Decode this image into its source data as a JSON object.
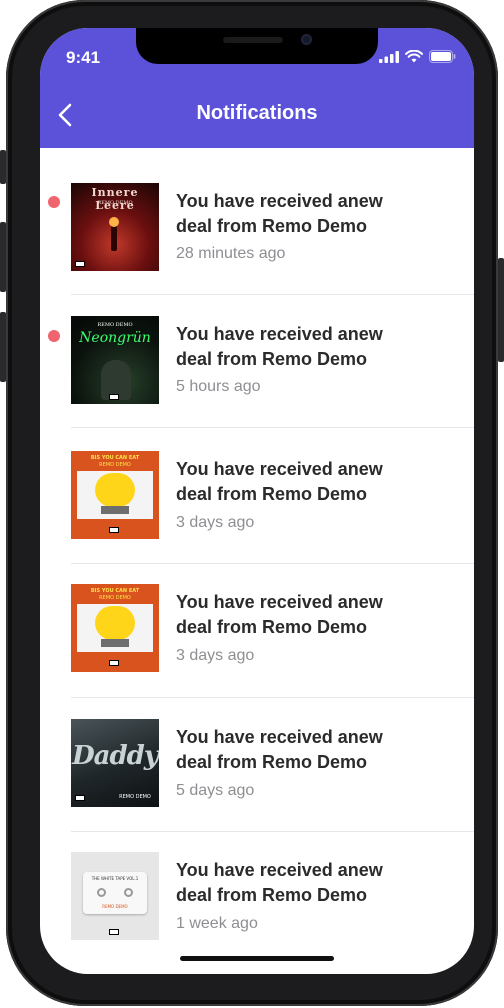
{
  "status_bar": {
    "time": "9:41"
  },
  "header": {
    "title": "Notifications"
  },
  "notifications": [
    {
      "message": "You have received anew deal from Remo Demo",
      "time_ago": "28 minutes ago",
      "unread": true,
      "cover_title": "Innere Leere",
      "cover_artist": "REMO DEMO"
    },
    {
      "message": "You have received anew deal from Remo Demo",
      "time_ago": "5 hours ago",
      "unread": true,
      "cover_title": "Neongrün",
      "cover_artist": "REMO DEMO"
    },
    {
      "message": "You have received anew deal from Remo Demo",
      "time_ago": "3 days ago",
      "unread": false,
      "cover_title": "BIS YOU CAN EAT",
      "cover_artist": "REMO DEMO"
    },
    {
      "message": "You have received anew deal from Remo Demo",
      "time_ago": "3 days ago",
      "unread": false,
      "cover_title": "BIS YOU CAN EAT",
      "cover_artist": "REMO DEMO"
    },
    {
      "message": "You have received anew deal from Remo Demo",
      "time_ago": "5 days ago",
      "unread": false,
      "cover_title": "Daddy",
      "cover_artist": "REMO DEMO"
    },
    {
      "message": "You have received anew deal from Remo Demo",
      "time_ago": "1 week ago",
      "unread": false,
      "cover_title": "THE WHITE TAPE VOL.1",
      "cover_artist": "REMO DEMO"
    }
  ],
  "colors": {
    "header": "#5b52d9",
    "unread_dot": "#f0646e",
    "text": "#2b2b2b",
    "muted": "#8e8e93"
  }
}
